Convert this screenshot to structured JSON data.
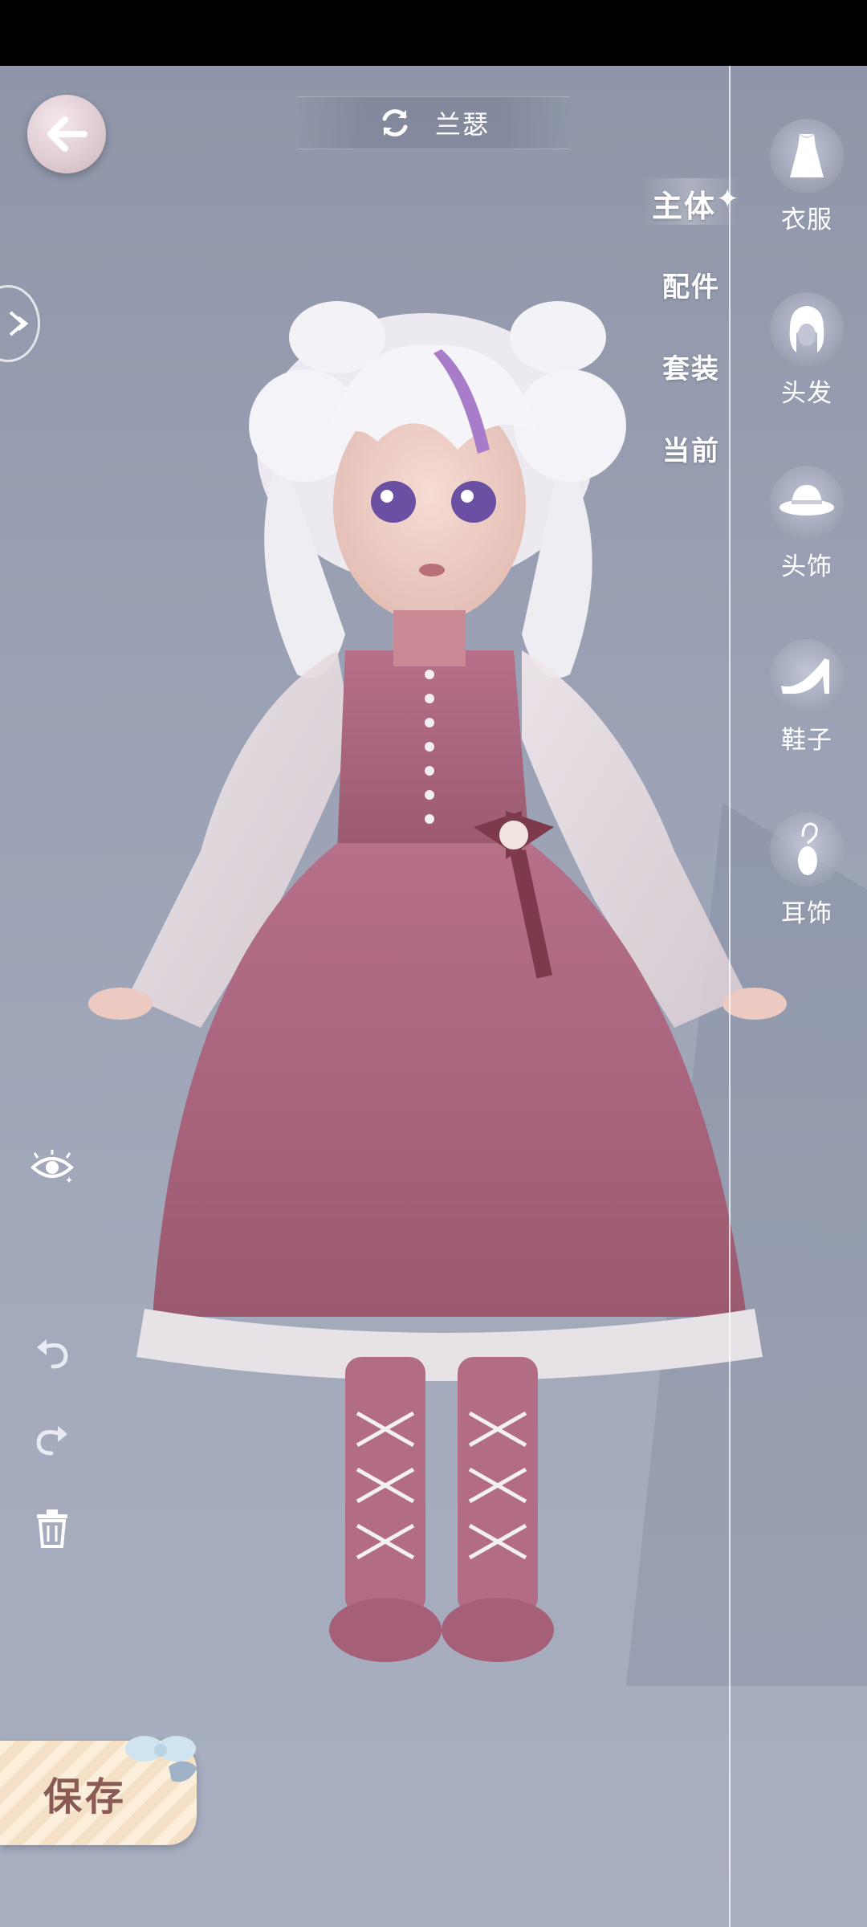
{
  "header": {
    "character_name": "兰瑟"
  },
  "tabs": [
    {
      "label": "主体",
      "active": true
    },
    {
      "label": "配件",
      "active": false
    },
    {
      "label": "套装",
      "active": false
    },
    {
      "label": "当前",
      "active": false
    }
  ],
  "categories": [
    {
      "label": "衣服",
      "icon": "dress-icon"
    },
    {
      "label": "头发",
      "icon": "hair-icon"
    },
    {
      "label": "头饰",
      "icon": "hat-icon"
    },
    {
      "label": "鞋子",
      "icon": "shoe-icon"
    },
    {
      "label": "耳饰",
      "icon": "earring-icon"
    }
  ],
  "tools": [
    "eye-toggle-icon",
    "undo-icon",
    "redo-icon",
    "trash-icon"
  ],
  "save": {
    "label": "保存"
  },
  "colors": {
    "background": "#9aa1b4",
    "dress": "#a8657a",
    "hair": "#f2f1f4",
    "hair_accent": "#a87cc9",
    "save_text": "#8a5a55"
  }
}
